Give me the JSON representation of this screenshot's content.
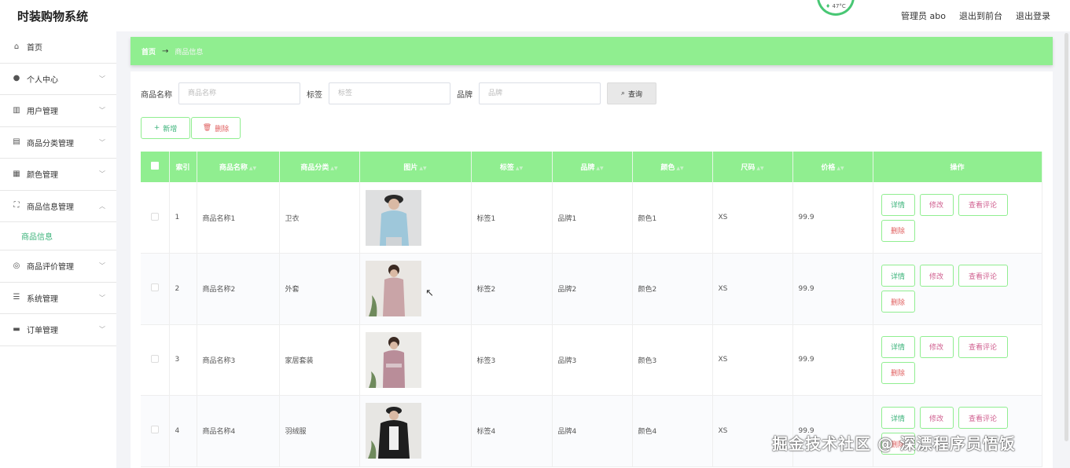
{
  "app": {
    "title": "时装购物系统"
  },
  "top_nav": {
    "admin": "管理员 abo",
    "to_front": "退出到前台",
    "logout": "退出登录",
    "temperature": "47°C"
  },
  "sidebar": {
    "items": [
      {
        "label": "首页",
        "icon": "home-icon",
        "has_children": false
      },
      {
        "label": "个人中心",
        "icon": "user-icon",
        "has_children": true
      },
      {
        "label": "用户管理",
        "icon": "bar-chart-icon",
        "has_children": true
      },
      {
        "label": "商品分类管理",
        "icon": "shop-icon",
        "has_children": true
      },
      {
        "label": "颜色管理",
        "icon": "clipboard-icon",
        "has_children": true
      },
      {
        "label": "商品信息管理",
        "icon": "frame-icon",
        "has_children": true,
        "expanded": true
      },
      {
        "label": "商品评价管理",
        "icon": "compass-icon",
        "has_children": true
      },
      {
        "label": "系统管理",
        "icon": "list-icon",
        "has_children": true
      },
      {
        "label": "订单管理",
        "icon": "truck-icon",
        "has_children": true
      }
    ],
    "submenu": {
      "label": "商品信息"
    }
  },
  "breadcrumb": {
    "home": "首页",
    "separator": "→",
    "current": "商品信息"
  },
  "search": {
    "name_label": "商品名称",
    "name_placeholder": "商品名称",
    "tag_label": "标签",
    "tag_placeholder": "标签",
    "brand_label": "品牌",
    "brand_placeholder": "品牌",
    "query_button": "查询"
  },
  "actions": {
    "add": "新增",
    "delete": "删除"
  },
  "table": {
    "columns": [
      "索引",
      "商品名称",
      "商品分类",
      "图片",
      "标签",
      "品牌",
      "颜色",
      "尺码",
      "价格",
      "操作"
    ],
    "rows": [
      {
        "index": "1",
        "name": "商品名称1",
        "category": "卫衣",
        "tag": "标签1",
        "brand": "品牌1",
        "color": "颜色1",
        "size": "XS",
        "price": "99.9"
      },
      {
        "index": "2",
        "name": "商品名称2",
        "category": "外套",
        "tag": "标签2",
        "brand": "品牌2",
        "color": "颜色2",
        "size": "XS",
        "price": "99.9"
      },
      {
        "index": "3",
        "name": "商品名称3",
        "category": "家居套装",
        "tag": "标签3",
        "brand": "品牌3",
        "color": "颜色3",
        "size": "XS",
        "price": "99.9"
      },
      {
        "index": "4",
        "name": "商品名称4",
        "category": "羽绒服",
        "tag": "标签4",
        "brand": "品牌4",
        "color": "颜色4",
        "size": "XS",
        "price": "99.9"
      }
    ],
    "ops": {
      "detail": "详情",
      "edit": "修改",
      "comment": "查看评论",
      "delete": "删除"
    }
  },
  "watermark": "掘金技术社区 @ 深漂程序员悟饭",
  "colors": {
    "accent": "#90ee90",
    "accent_text": "#3bb37a",
    "danger": "#e06060",
    "pink": "#d06090"
  }
}
